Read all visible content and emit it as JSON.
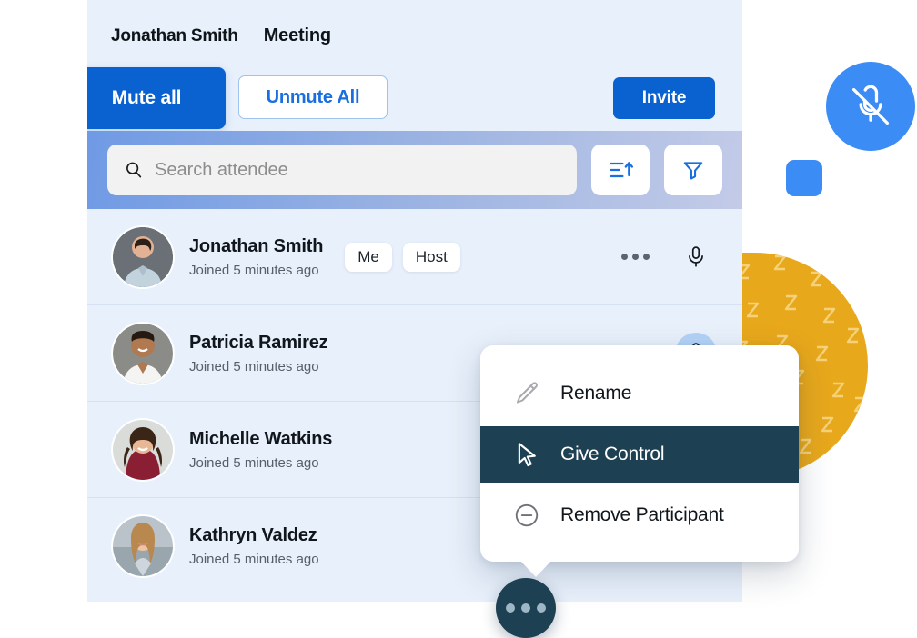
{
  "header": {
    "user_name": "Jonathan Smith",
    "meeting_label": "Meeting",
    "mute_all_label": "Mute all",
    "unmute_all_label": "Unmute All",
    "invite_label": "Invite"
  },
  "search": {
    "placeholder": "Search attendee",
    "value": "",
    "search_icon": "search-icon",
    "sort_icon": "sort-ascending-icon",
    "filter_icon": "filter-funnel-icon"
  },
  "participants": [
    {
      "name": "Jonathan Smith",
      "joined": "Joined 5 minutes ago",
      "badges": [
        "Me",
        "Host"
      ],
      "mic_state": "unmuted",
      "mic_highlight": false
    },
    {
      "name": "Patricia Ramirez",
      "joined": "Joined 5 minutes ago",
      "badges": [],
      "mic_state": "unmuted",
      "mic_highlight": true
    },
    {
      "name": "Michelle Watkins",
      "joined": "Joined 5 minutes ago",
      "badges": [],
      "mic_state": "unmuted",
      "mic_highlight": false
    },
    {
      "name": "Kathryn Valdez",
      "joined": "Joined 5 minutes ago",
      "badges": [],
      "mic_state": "unmuted",
      "mic_highlight": false
    }
  ],
  "context_menu": {
    "items": [
      {
        "label": "Rename",
        "icon": "pencil-icon",
        "highlighted": false
      },
      {
        "label": "Give Control",
        "icon": "cursor-arrow-icon",
        "highlighted": true
      },
      {
        "label": "Remove Participant",
        "icon": "minus-circle-icon",
        "highlighted": false
      }
    ]
  },
  "fab": {
    "icon": "more-horizontal-icon"
  },
  "decoration": {
    "mic_muted_icon": "microphone-muted-icon",
    "accent_blue": "#3b8cf4",
    "accent_gold": "#e8a81c",
    "accent_navy": "#1d4052",
    "primary_blue": "#0a62d0"
  }
}
